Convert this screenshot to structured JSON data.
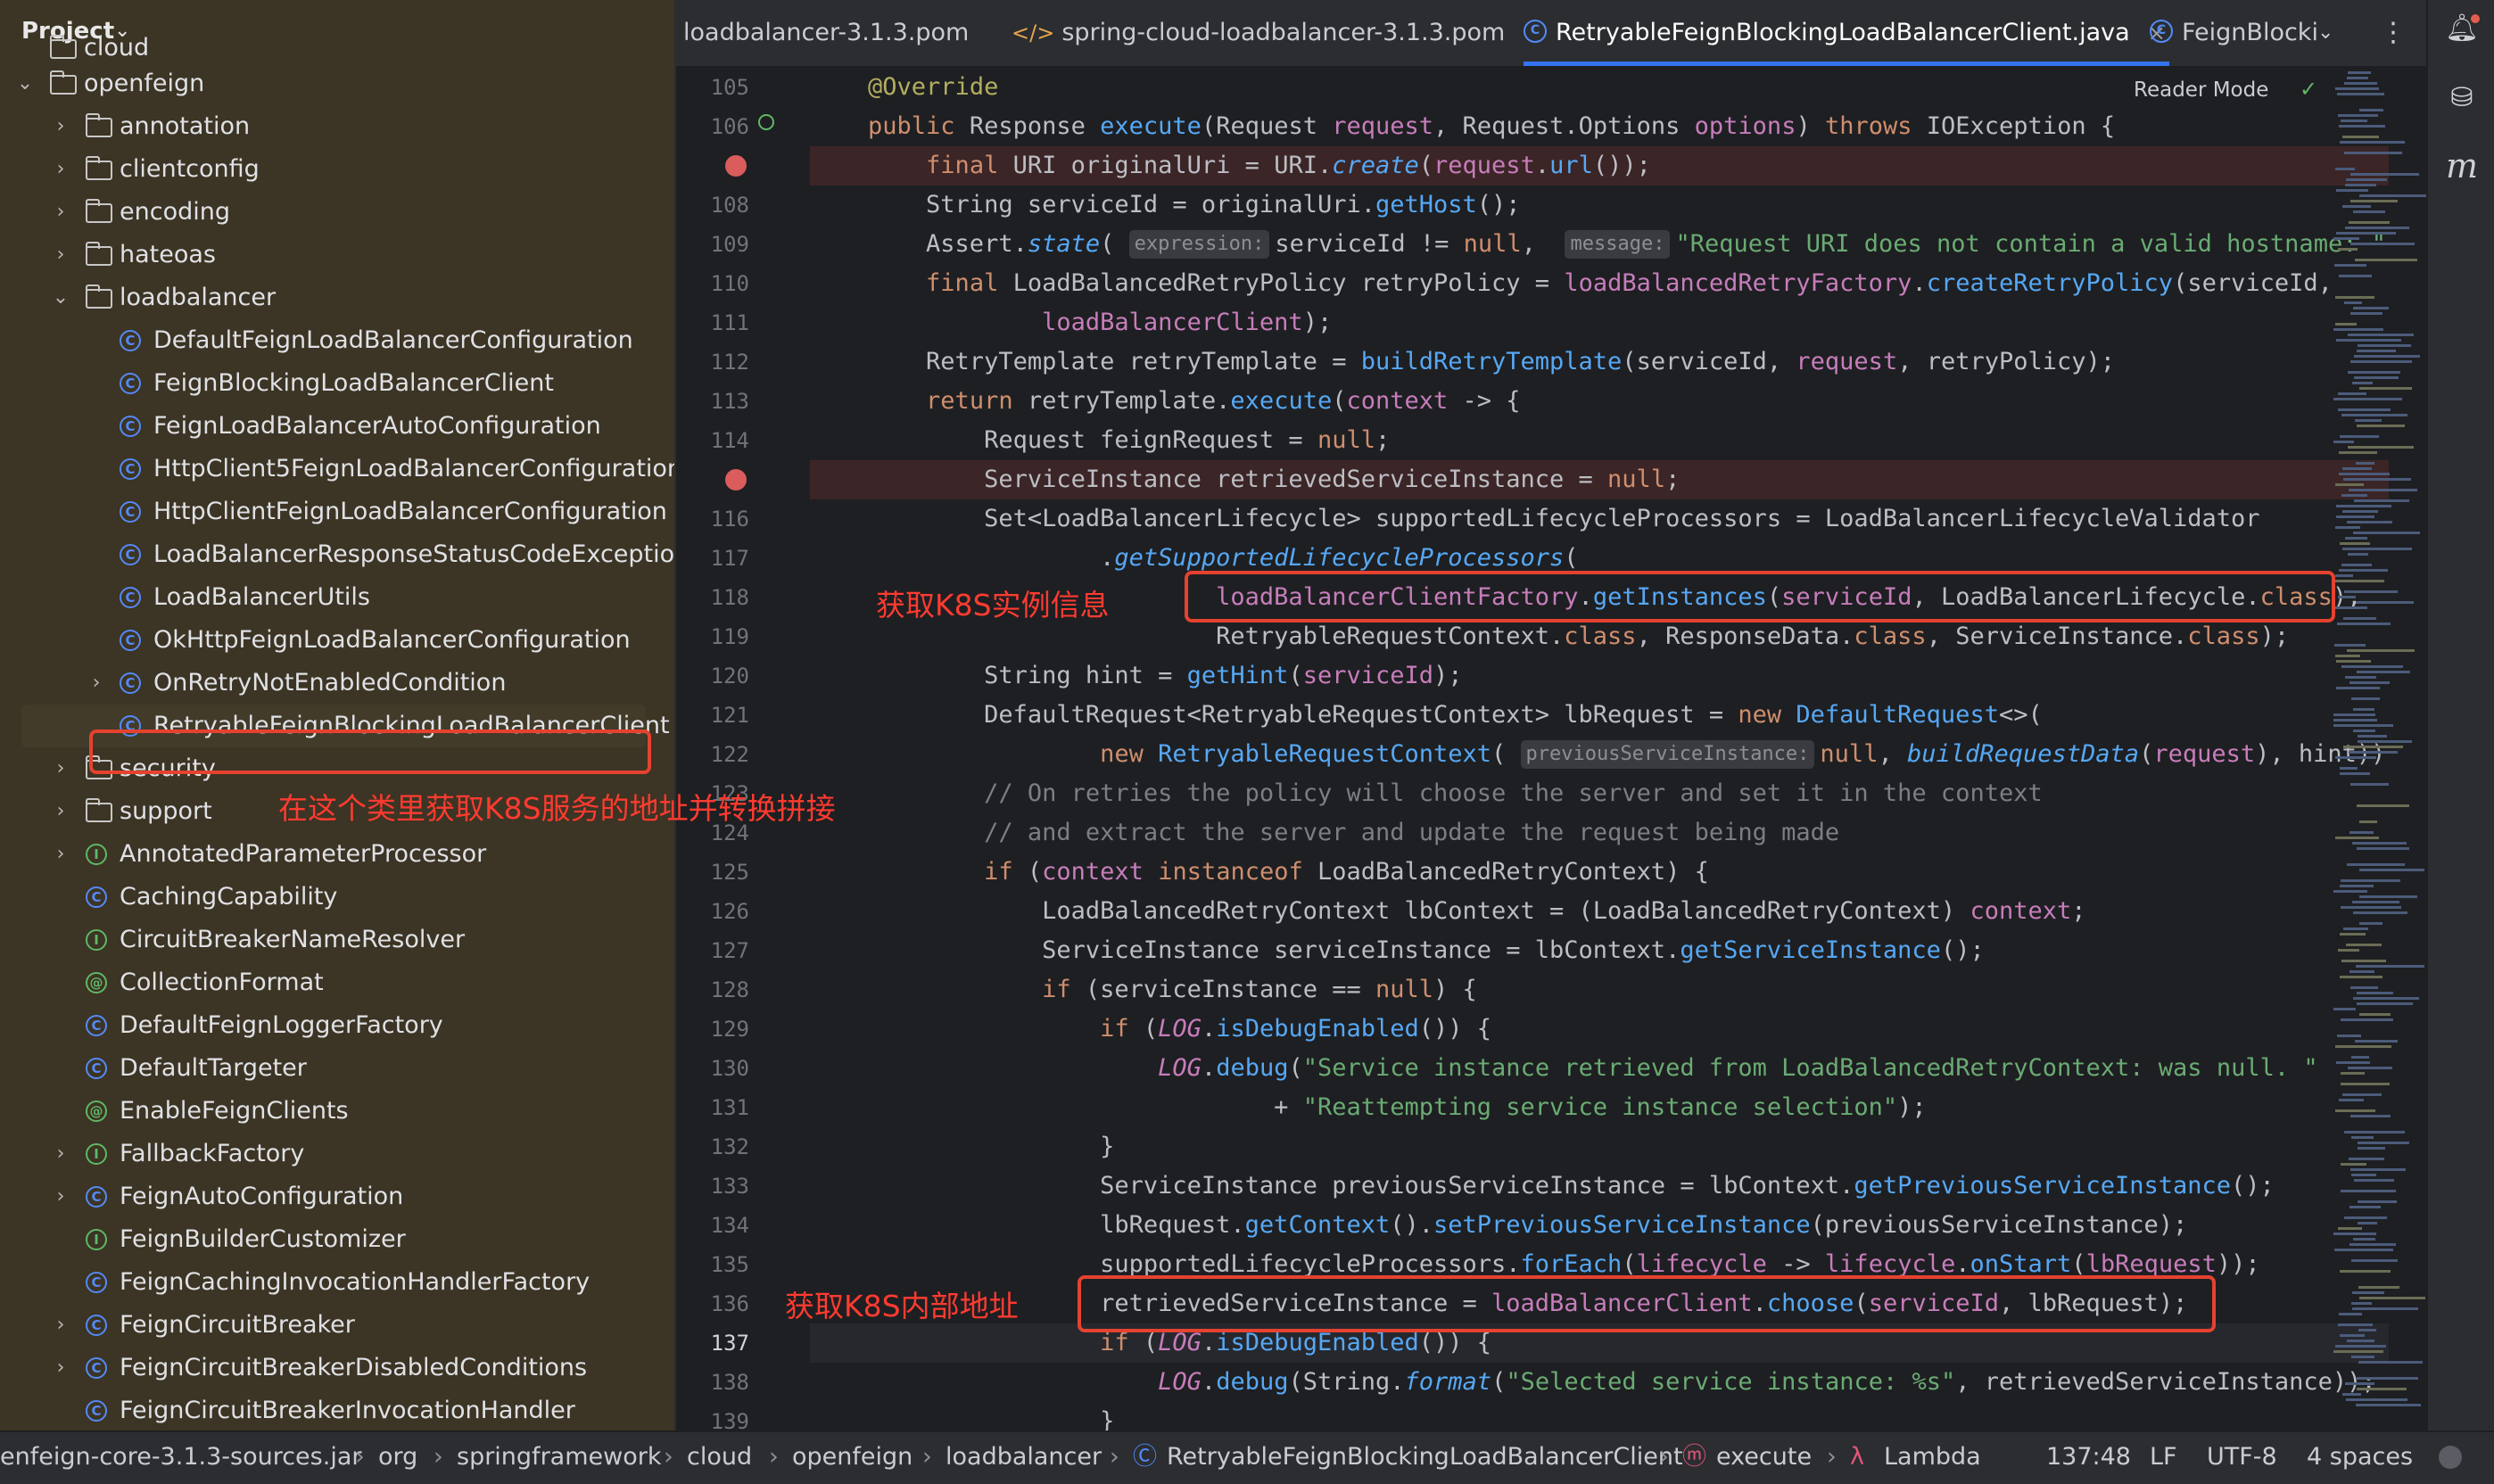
{
  "project": {
    "title": "Project",
    "tree": [
      {
        "label": "cloud",
        "type": "folder",
        "depth": 0,
        "arrow": ""
      },
      {
        "label": "openfeign",
        "type": "folder",
        "depth": 0,
        "arrow": "⌄"
      },
      {
        "label": "annotation",
        "type": "folder",
        "depth": 1,
        "arrow": "›"
      },
      {
        "label": "clientconfig",
        "type": "folder",
        "depth": 1,
        "arrow": "›"
      },
      {
        "label": "encoding",
        "type": "folder",
        "depth": 1,
        "arrow": "›"
      },
      {
        "label": "hateoas",
        "type": "folder",
        "depth": 1,
        "arrow": "›"
      },
      {
        "label": "loadbalancer",
        "type": "folder",
        "depth": 1,
        "arrow": "⌄"
      },
      {
        "label": "DefaultFeignLoadBalancerConfiguration",
        "type": "class",
        "depth": 2,
        "arrow": ""
      },
      {
        "label": "FeignBlockingLoadBalancerClient",
        "type": "class",
        "depth": 2,
        "arrow": ""
      },
      {
        "label": "FeignLoadBalancerAutoConfiguration",
        "type": "class",
        "depth": 2,
        "arrow": ""
      },
      {
        "label": "HttpClient5FeignLoadBalancerConfiguration",
        "type": "class",
        "depth": 2,
        "arrow": ""
      },
      {
        "label": "HttpClientFeignLoadBalancerConfiguration",
        "type": "class",
        "depth": 2,
        "arrow": ""
      },
      {
        "label": "LoadBalancerResponseStatusCodeException",
        "type": "class",
        "depth": 2,
        "arrow": ""
      },
      {
        "label": "LoadBalancerUtils",
        "type": "class",
        "depth": 2,
        "arrow": ""
      },
      {
        "label": "OkHttpFeignLoadBalancerConfiguration",
        "type": "class",
        "depth": 2,
        "arrow": ""
      },
      {
        "label": "OnRetryNotEnabledCondition",
        "type": "class",
        "depth": 2,
        "arrow": "›"
      },
      {
        "label": "RetryableFeignBlockingLoadBalancerClient",
        "type": "class",
        "depth": 2,
        "arrow": "",
        "selected": true
      },
      {
        "label": "security",
        "type": "folder",
        "depth": 1,
        "arrow": "›"
      },
      {
        "label": "support",
        "type": "folder",
        "depth": 1,
        "arrow": "›"
      },
      {
        "label": "AnnotatedParameterProcessor",
        "type": "interface",
        "depth": 1,
        "arrow": "›"
      },
      {
        "label": "CachingCapability",
        "type": "class",
        "depth": 1,
        "arrow": ""
      },
      {
        "label": "CircuitBreakerNameResolver",
        "type": "interface",
        "depth": 1,
        "arrow": ""
      },
      {
        "label": "CollectionFormat",
        "type": "annotation",
        "depth": 1,
        "arrow": ""
      },
      {
        "label": "DefaultFeignLoggerFactory",
        "type": "class",
        "depth": 1,
        "arrow": ""
      },
      {
        "label": "DefaultTargeter",
        "type": "class",
        "depth": 1,
        "arrow": ""
      },
      {
        "label": "EnableFeignClients",
        "type": "annotation",
        "depth": 1,
        "arrow": ""
      },
      {
        "label": "FallbackFactory",
        "type": "interface",
        "depth": 1,
        "arrow": "›"
      },
      {
        "label": "FeignAutoConfiguration",
        "type": "class",
        "depth": 1,
        "arrow": "›"
      },
      {
        "label": "FeignBuilderCustomizer",
        "type": "interface",
        "depth": 1,
        "arrow": ""
      },
      {
        "label": "FeignCachingInvocationHandlerFactory",
        "type": "class",
        "depth": 1,
        "arrow": ""
      },
      {
        "label": "FeignCircuitBreaker",
        "type": "class",
        "depth": 1,
        "arrow": "›"
      },
      {
        "label": "FeignCircuitBreakerDisabledConditions",
        "type": "class",
        "depth": 1,
        "arrow": "›"
      },
      {
        "label": "FeignCircuitBreakerInvocationHandler",
        "type": "class",
        "depth": 1,
        "arrow": ""
      }
    ]
  },
  "tabs": [
    {
      "label": "loadbalancer-3.1.3.pom",
      "kind": "pom"
    },
    {
      "label": "spring-cloud-loadbalancer-3.1.3.pom",
      "kind": "xml"
    },
    {
      "label": "RetryableFeignBlockingLoadBalancerClient.java",
      "kind": "class",
      "active": true
    },
    {
      "label": "FeignBlocki",
      "kind": "class"
    }
  ],
  "editor": {
    "reader_mode": "Reader Mode",
    "current_line": "137",
    "breakpoint_lines": [
      "107",
      "115"
    ],
    "line_numbers": [
      "105",
      "106",
      "",
      "108",
      "109",
      "110",
      "111",
      "112",
      "113",
      "114",
      "",
      "116",
      "117",
      "118",
      "119",
      "120",
      "121",
      "122",
      "123",
      "124",
      "125",
      "126",
      "127",
      "128",
      "129",
      "130",
      "131",
      "132",
      "133",
      "134",
      "135",
      "136",
      "137",
      "138",
      "139"
    ],
    "hints": {
      "expression": "expression:",
      "message": "message:",
      "previous_service_instance": "previousServiceInstance:"
    }
  },
  "annotations": {
    "get_k8s_instance": "获取K8S实例信息",
    "class_note": "在这个类里获取K8S服务的地址并转换拼接",
    "get_k8s_internal": "获取K8S内部地址"
  },
  "status": {
    "breadcrumbs": [
      "enfeign-core-3.1.3-sources.jar",
      "org",
      "springframework",
      "cloud",
      "openfeign",
      "loadbalancer",
      "RetryableFeignBlockingLoadBalancerClient",
      "execute",
      "Lambda"
    ],
    "position": "137:48",
    "line_sep": "LF",
    "encoding": "UTF-8",
    "indent": "4 spaces"
  },
  "colors": {
    "accent": "#3574f0",
    "annotation_red": "#e5422f",
    "breakpoint": "#db5c5c"
  }
}
